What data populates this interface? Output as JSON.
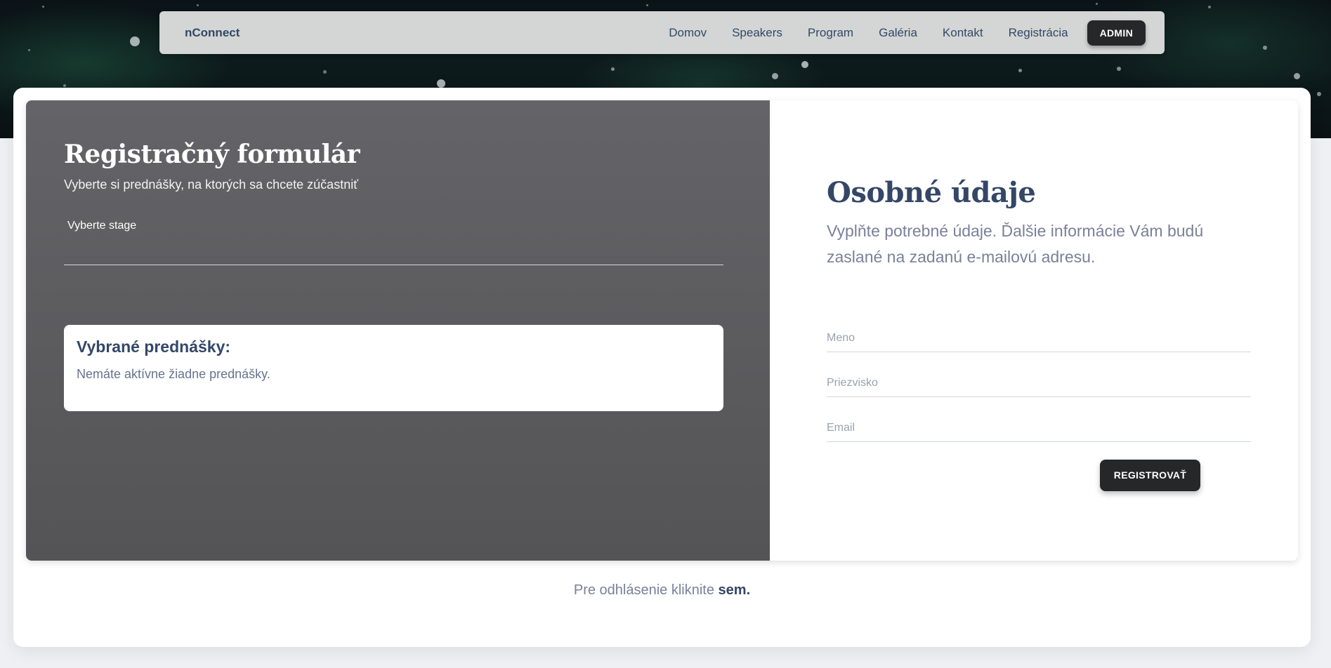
{
  "navbar": {
    "brand": "nConnect",
    "links": [
      "Domov",
      "Speakers",
      "Program",
      "Galéria",
      "Kontakt",
      "Registrácia"
    ],
    "admin_label": "ADMIN"
  },
  "left": {
    "title": "Registračný formulár",
    "subtitle": "Vyberte si prednášky, na ktorých sa chcete zúčastniť",
    "stage_label": "Vyberte stage",
    "selected_title": "Vybrané prednášky:",
    "selected_text": "Nemáte aktívne žiadne prednášky."
  },
  "right": {
    "title": "Osobné údaje",
    "subtitle": "Vyplňte potrebné údaje. Ďalšie informácie Vám budú zaslané na zadanú e-mailovú adresu.",
    "fields": {
      "first_name": {
        "placeholder": "Meno",
        "value": ""
      },
      "last_name": {
        "placeholder": "Priezvisko",
        "value": ""
      },
      "email": {
        "placeholder": "Email",
        "value": ""
      }
    },
    "submit_label": "REGISTROVAŤ"
  },
  "footer": {
    "logout_text": "Pre odhlásenie kliknite",
    "logout_link": "sem."
  },
  "colors": {
    "primary_text": "#344767",
    "secondary_text": "#7b809a",
    "dark_button": "#252729",
    "left_panel": "#5c5c5f"
  }
}
